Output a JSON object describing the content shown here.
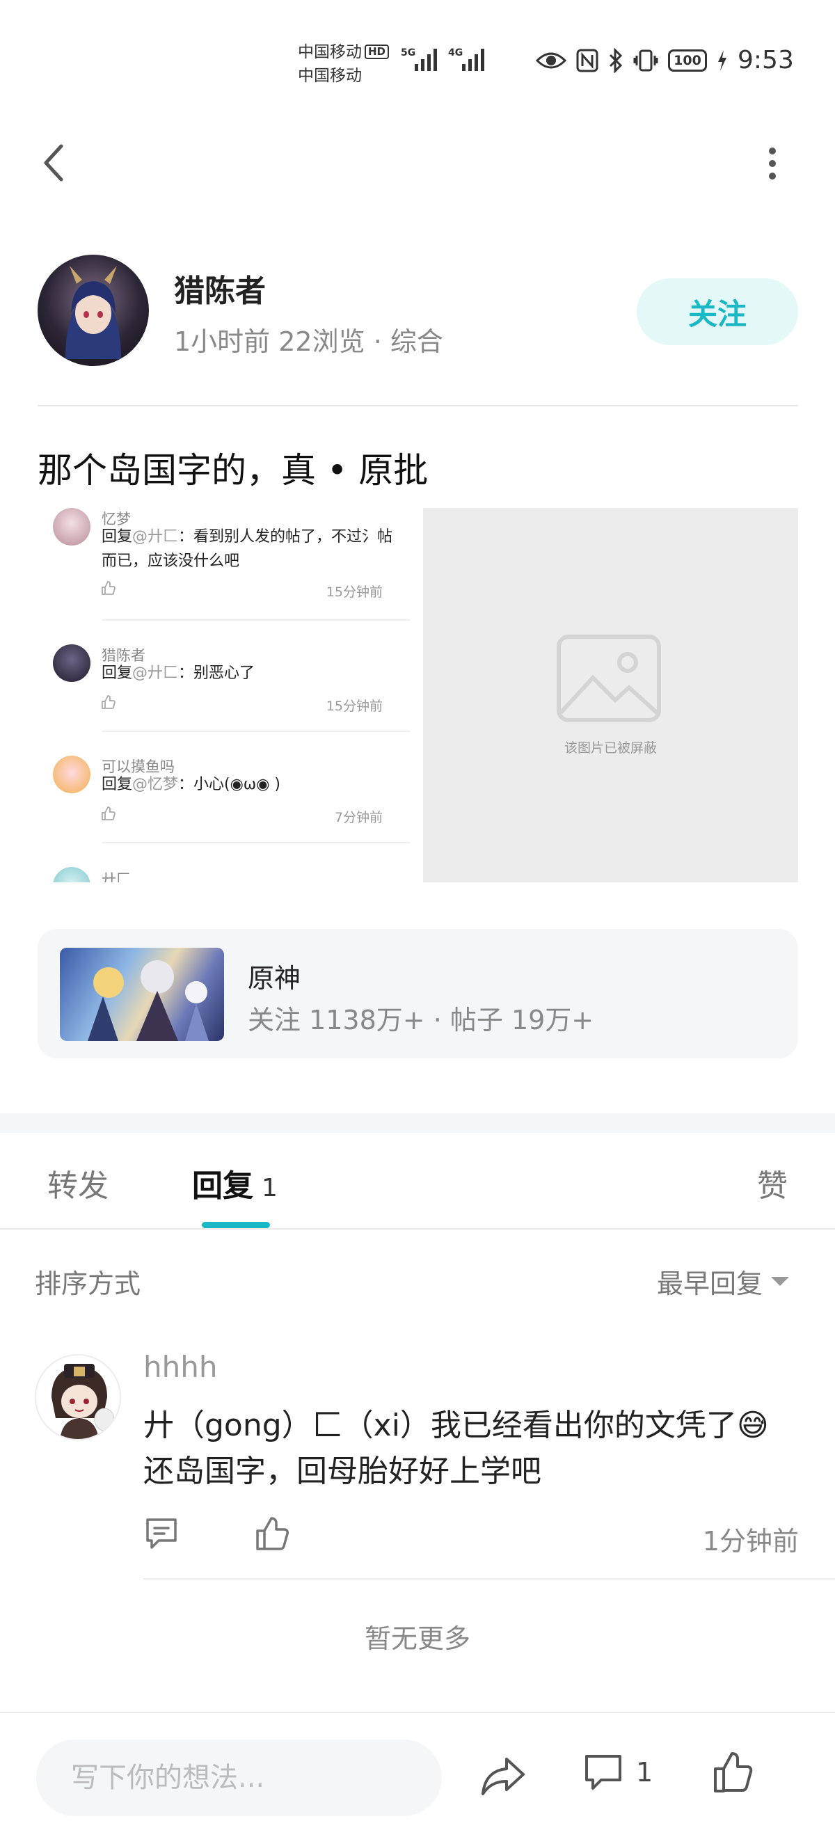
{
  "status_bar": {
    "carrier_1": "中国移动",
    "hd": "HD",
    "carrier_2": "中国移动",
    "net_1": "5G",
    "net_2": "4G",
    "battery": "100",
    "time": "9:53"
  },
  "author": {
    "name": "猎陈者",
    "meta": "1小时前  22浏览  ·  综合",
    "follow_label": "关注"
  },
  "post": {
    "title": "那个岛国字的，真 • 原批"
  },
  "embedded_comments": [
    {
      "name": "忆梦",
      "prefix": "回复",
      "at": "@廾匚",
      "text": "：看到别人发的帖了，不过氵帖而已，应该没什么吧",
      "time": "15分钟前"
    },
    {
      "name": "猎陈者",
      "prefix": "回复",
      "at": "@廾匚",
      "text": "：别恶心了",
      "time": "15分钟前"
    },
    {
      "name": "可以摸鱼吗",
      "prefix": "回复",
      "at": "@忆梦",
      "text": "：小心(◉ω◉ )",
      "time": "7分钟前"
    },
    {
      "name": "廾匚",
      "prefix": "",
      "at": "",
      "text": "",
      "time": ""
    }
  ],
  "blocked_image": {
    "label": "该图片已被屏蔽"
  },
  "forum": {
    "name": "原神",
    "stats": "关注 1138万+  ·  帖子 19万+"
  },
  "tabs": {
    "repost": "转发",
    "reply": "回复",
    "reply_count": "1",
    "like": "赞"
  },
  "sort": {
    "label": "排序方式",
    "value": "最早回复"
  },
  "reply": {
    "name": "hhhh",
    "line_1": "廾（gong）匚（xi）我已经看出你的文凭了😅",
    "line_2": "还岛国字，回母胎好好上学吧",
    "time": "1分钟前"
  },
  "no_more": "暂无更多",
  "bottom_bar": {
    "input_placeholder": "写下你的想法...",
    "comment_count": "1"
  },
  "colors": {
    "accent": "#1ab8c4",
    "follow_bg": "#e5f8f8"
  }
}
